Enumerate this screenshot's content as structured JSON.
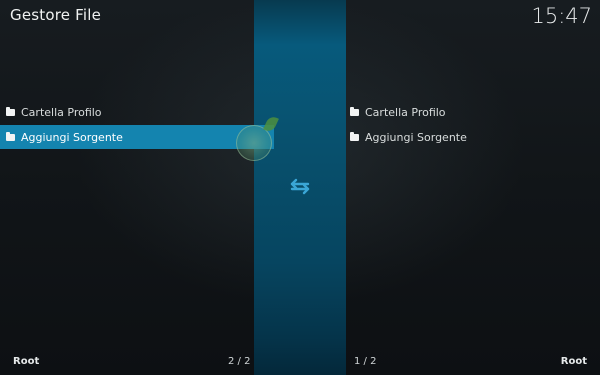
{
  "header": {
    "title": "Gestore File",
    "clock": "15:47"
  },
  "left_pane": {
    "items": [
      {
        "label": "Cartella Profilo",
        "icon": "folder-icon"
      },
      {
        "label": "Aggiungi Sorgente",
        "icon": "folder-icon",
        "selected": true
      }
    ],
    "footer_label": "Root",
    "page_indicator": "2 / 2"
  },
  "right_pane": {
    "items": [
      {
        "label": "Cartella Profilo",
        "icon": "folder-icon"
      },
      {
        "label": "Aggiungi Sorgente",
        "icon": "folder-icon"
      }
    ],
    "footer_label": "Root",
    "page_indicator": "1 / 2"
  },
  "center": {
    "swap_icon": "swap-arrows-icon"
  },
  "colors": {
    "accent": "#1484af",
    "center_strip": "#075a7c",
    "swap_icon": "#3aa6d6"
  }
}
